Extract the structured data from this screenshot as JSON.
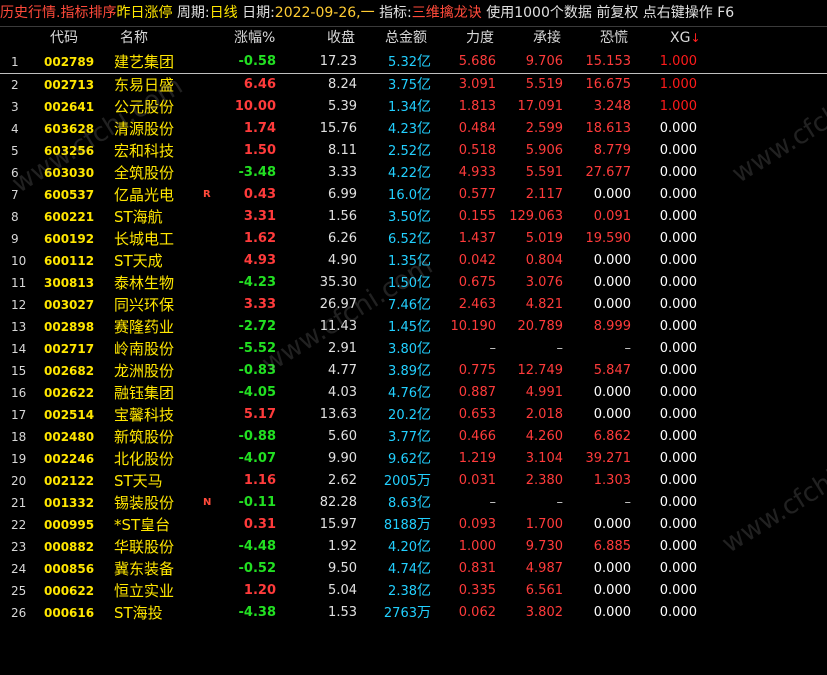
{
  "topbar": {
    "history": "历史行情",
    "sort_by": ".指标排序",
    "sort_field": "昨日涨停",
    "period_label": "周期:",
    "period_value": "日线",
    "date_label": "日期:",
    "date_value": "2022-09-26,一",
    "indicator_label": "指标:",
    "indicator_value": "三维擒龙诀",
    "usage_prefix": "使用",
    "usage_count": "1000",
    "usage_suffix": "个数据",
    "adjust": "前复权",
    "right_click_hint": "点右键操作",
    "function_key": "F6"
  },
  "columns": {
    "code": "代码",
    "name": "名称",
    "change": "涨幅%",
    "close": "收盘",
    "amount": "总金额",
    "strength": "力度",
    "support": "承接",
    "panic": "恐慌",
    "xg": "XG"
  },
  "watermark": "www.cfchi.com",
  "colors": {
    "up": "#ff3b3b",
    "down": "#22e022",
    "code": "#ffe600",
    "amount": "#22d0ff",
    "background": "#000000"
  },
  "rows": [
    {
      "idx": "1",
      "code": "002789",
      "name": "建艺集团",
      "flag": "",
      "change": "-0.58",
      "dir": "down",
      "close": "17.23",
      "amt_num": "5.32",
      "amt_unit": "亿",
      "strength": "5.686",
      "support": "9.706",
      "panic": "15.153",
      "xg": "1.000",
      "xg_red": true
    },
    {
      "idx": "2",
      "code": "002713",
      "name": "东易日盛",
      "flag": "",
      "change": "6.46",
      "dir": "up",
      "close": "8.24",
      "amt_num": "3.75",
      "amt_unit": "亿",
      "strength": "3.091",
      "support": "5.519",
      "panic": "16.675",
      "xg": "1.000",
      "xg_red": true
    },
    {
      "idx": "3",
      "code": "002641",
      "name": "公元股份",
      "flag": "",
      "change": "10.00",
      "dir": "up",
      "close": "5.39",
      "amt_num": "1.34",
      "amt_unit": "亿",
      "strength": "1.813",
      "support": "17.091",
      "panic": "3.248",
      "xg": "1.000",
      "xg_red": true
    },
    {
      "idx": "4",
      "code": "603628",
      "name": "清源股份",
      "flag": "",
      "change": "1.74",
      "dir": "up",
      "close": "15.76",
      "amt_num": "4.23",
      "amt_unit": "亿",
      "strength": "0.484",
      "support": "2.599",
      "panic": "18.613",
      "xg": "0.000",
      "xg_red": false
    },
    {
      "idx": "5",
      "code": "603256",
      "name": "宏和科技",
      "flag": "",
      "change": "1.50",
      "dir": "up",
      "close": "8.11",
      "amt_num": "2.52",
      "amt_unit": "亿",
      "strength": "0.518",
      "support": "5.906",
      "panic": "8.779",
      "xg": "0.000",
      "xg_red": false
    },
    {
      "idx": "6",
      "code": "603030",
      "name": "全筑股份",
      "flag": "",
      "change": "-3.48",
      "dir": "down",
      "close": "3.33",
      "amt_num": "4.22",
      "amt_unit": "亿",
      "strength": "4.933",
      "support": "5.591",
      "panic": "27.677",
      "xg": "0.000",
      "xg_red": false
    },
    {
      "idx": "7",
      "code": "600537",
      "name": "亿晶光电",
      "flag": "R",
      "change": "0.43",
      "dir": "up",
      "close": "6.99",
      "amt_num": "16.0",
      "amt_unit": "亿",
      "strength": "0.577",
      "support": "2.117",
      "panic": "0.000",
      "xg": "0.000",
      "xg_red": false
    },
    {
      "idx": "8",
      "code": "600221",
      "name": "ST海航",
      "flag": "",
      "change": "3.31",
      "dir": "up",
      "close": "1.56",
      "amt_num": "3.50",
      "amt_unit": "亿",
      "strength": "0.155",
      "support": "129.063",
      "panic": "0.091",
      "xg": "0.000",
      "xg_red": false
    },
    {
      "idx": "9",
      "code": "600192",
      "name": "长城电工",
      "flag": "",
      "change": "1.62",
      "dir": "up",
      "close": "6.26",
      "amt_num": "6.52",
      "amt_unit": "亿",
      "strength": "1.437",
      "support": "5.019",
      "panic": "19.590",
      "xg": "0.000",
      "xg_red": false
    },
    {
      "idx": "10",
      "code": "600112",
      "name": "ST天成",
      "flag": "",
      "change": "4.93",
      "dir": "up",
      "close": "4.90",
      "amt_num": "1.35",
      "amt_unit": "亿",
      "strength": "0.042",
      "support": "0.804",
      "panic": "0.000",
      "xg": "0.000",
      "xg_red": false
    },
    {
      "idx": "11",
      "code": "300813",
      "name": "泰林生物",
      "flag": "",
      "change": "-4.23",
      "dir": "down",
      "close": "35.30",
      "amt_num": "1.50",
      "amt_unit": "亿",
      "strength": "0.675",
      "support": "3.076",
      "panic": "0.000",
      "xg": "0.000",
      "xg_red": false
    },
    {
      "idx": "12",
      "code": "003027",
      "name": "同兴环保",
      "flag": "",
      "change": "3.33",
      "dir": "up",
      "close": "26.97",
      "amt_num": "7.46",
      "amt_unit": "亿",
      "strength": "2.463",
      "support": "4.821",
      "panic": "0.000",
      "xg": "0.000",
      "xg_red": false
    },
    {
      "idx": "13",
      "code": "002898",
      "name": "赛隆药业",
      "flag": "",
      "change": "-2.72",
      "dir": "down",
      "close": "11.43",
      "amt_num": "1.45",
      "amt_unit": "亿",
      "strength": "10.190",
      "support": "20.789",
      "panic": "8.999",
      "xg": "0.000",
      "xg_red": false
    },
    {
      "idx": "14",
      "code": "002717",
      "name": "岭南股份",
      "flag": "",
      "change": "-5.52",
      "dir": "down",
      "close": "2.91",
      "amt_num": "3.80",
      "amt_unit": "亿",
      "strength": "–",
      "support": "–",
      "panic": "–",
      "xg": "0.000",
      "xg_red": false
    },
    {
      "idx": "15",
      "code": "002682",
      "name": "龙洲股份",
      "flag": "",
      "change": "-0.83",
      "dir": "down",
      "close": "4.77",
      "amt_num": "3.89",
      "amt_unit": "亿",
      "strength": "0.775",
      "support": "12.749",
      "panic": "5.847",
      "xg": "0.000",
      "xg_red": false
    },
    {
      "idx": "16",
      "code": "002622",
      "name": "融钰集团",
      "flag": "",
      "change": "-4.05",
      "dir": "down",
      "close": "4.03",
      "amt_num": "4.76",
      "amt_unit": "亿",
      "strength": "0.887",
      "support": "4.991",
      "panic": "0.000",
      "xg": "0.000",
      "xg_red": false
    },
    {
      "idx": "17",
      "code": "002514",
      "name": "宝馨科技",
      "flag": "",
      "change": "5.17",
      "dir": "up",
      "close": "13.63",
      "amt_num": "20.2",
      "amt_unit": "亿",
      "strength": "0.653",
      "support": "2.018",
      "panic": "0.000",
      "xg": "0.000",
      "xg_red": false
    },
    {
      "idx": "18",
      "code": "002480",
      "name": "新筑股份",
      "flag": "",
      "change": "-0.88",
      "dir": "down",
      "close": "5.60",
      "amt_num": "3.77",
      "amt_unit": "亿",
      "strength": "0.466",
      "support": "4.260",
      "panic": "6.862",
      "xg": "0.000",
      "xg_red": false
    },
    {
      "idx": "19",
      "code": "002246",
      "name": "北化股份",
      "flag": "",
      "change": "-4.07",
      "dir": "down",
      "close": "9.90",
      "amt_num": "9.62",
      "amt_unit": "亿",
      "strength": "1.219",
      "support": "3.104",
      "panic": "39.271",
      "xg": "0.000",
      "xg_red": false
    },
    {
      "idx": "20",
      "code": "002122",
      "name": "ST天马",
      "flag": "",
      "change": "1.16",
      "dir": "up",
      "close": "2.62",
      "amt_num": "2005",
      "amt_unit": "万",
      "strength": "0.031",
      "support": "2.380",
      "panic": "1.303",
      "xg": "0.000",
      "xg_red": false
    },
    {
      "idx": "21",
      "code": "001332",
      "name": "锡装股份",
      "flag": "N",
      "change": "-0.11",
      "dir": "down",
      "close": "82.28",
      "amt_num": "8.63",
      "amt_unit": "亿",
      "strength": "–",
      "support": "–",
      "panic": "–",
      "xg": "0.000",
      "xg_red": false
    },
    {
      "idx": "22",
      "code": "000995",
      "name": "*ST皇台",
      "flag": "",
      "change": "0.31",
      "dir": "up",
      "close": "15.97",
      "amt_num": "8188",
      "amt_unit": "万",
      "strength": "0.093",
      "support": "1.700",
      "panic": "0.000",
      "xg": "0.000",
      "xg_red": false
    },
    {
      "idx": "23",
      "code": "000882",
      "name": "华联股份",
      "flag": "",
      "change": "-4.48",
      "dir": "down",
      "close": "1.92",
      "amt_num": "4.20",
      "amt_unit": "亿",
      "strength": "1.000",
      "support": "9.730",
      "panic": "6.885",
      "xg": "0.000",
      "xg_red": false
    },
    {
      "idx": "24",
      "code": "000856",
      "name": "冀东装备",
      "flag": "",
      "change": "-0.52",
      "dir": "down",
      "close": "9.50",
      "amt_num": "4.74",
      "amt_unit": "亿",
      "strength": "0.831",
      "support": "4.987",
      "panic": "0.000",
      "xg": "0.000",
      "xg_red": false
    },
    {
      "idx": "25",
      "code": "000622",
      "name": "恒立实业",
      "flag": "",
      "change": "1.20",
      "dir": "up",
      "close": "5.04",
      "amt_num": "2.38",
      "amt_unit": "亿",
      "strength": "0.335",
      "support": "6.561",
      "panic": "0.000",
      "xg": "0.000",
      "xg_red": false
    },
    {
      "idx": "26",
      "code": "000616",
      "name": "ST海投",
      "flag": "",
      "change": "-4.38",
      "dir": "down",
      "close": "1.53",
      "amt_num": "2763",
      "amt_unit": "万",
      "strength": "0.062",
      "support": "3.802",
      "panic": "0.000",
      "xg": "0.000",
      "xg_red": false
    }
  ]
}
